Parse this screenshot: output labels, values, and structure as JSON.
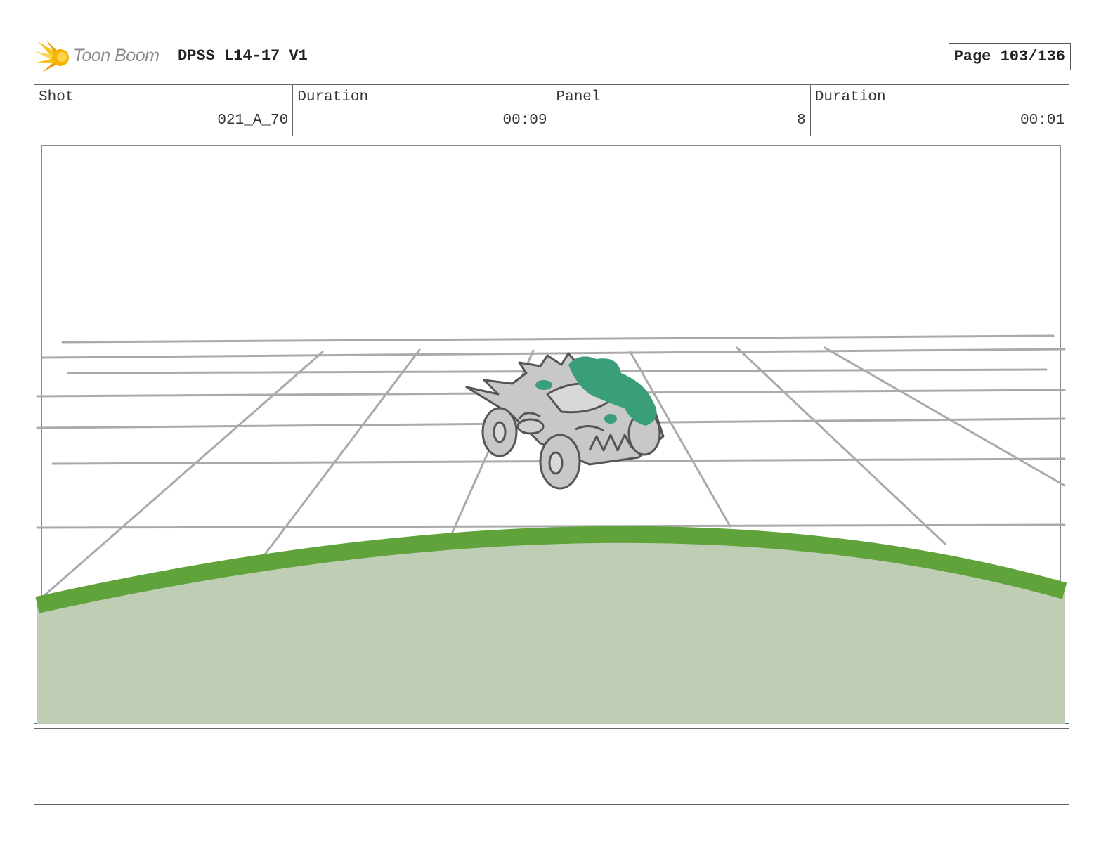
{
  "header": {
    "logo_text": "Toon Boom",
    "project_title": "DPSS L14-17 V1",
    "page_label": "Page 103/136"
  },
  "info": {
    "shot_label": "Shot",
    "shot_value": "021_A_70",
    "shot_duration_label": "Duration",
    "shot_duration_value": "00:09",
    "panel_label": "Panel",
    "panel_value": "8",
    "panel_duration_label": "Duration",
    "panel_duration_value": "00:01"
  },
  "colors": {
    "logo_yellow": "#f5c518",
    "logo_orange": "#f39c12",
    "field_fill": "#bfcdb5",
    "field_edge": "#5fa33a",
    "grid_line": "#aaaaaa",
    "car_body": "#c8c8c8",
    "car_outline": "#555555",
    "slime": "#3a9e78"
  },
  "notes": {
    "text": ""
  }
}
